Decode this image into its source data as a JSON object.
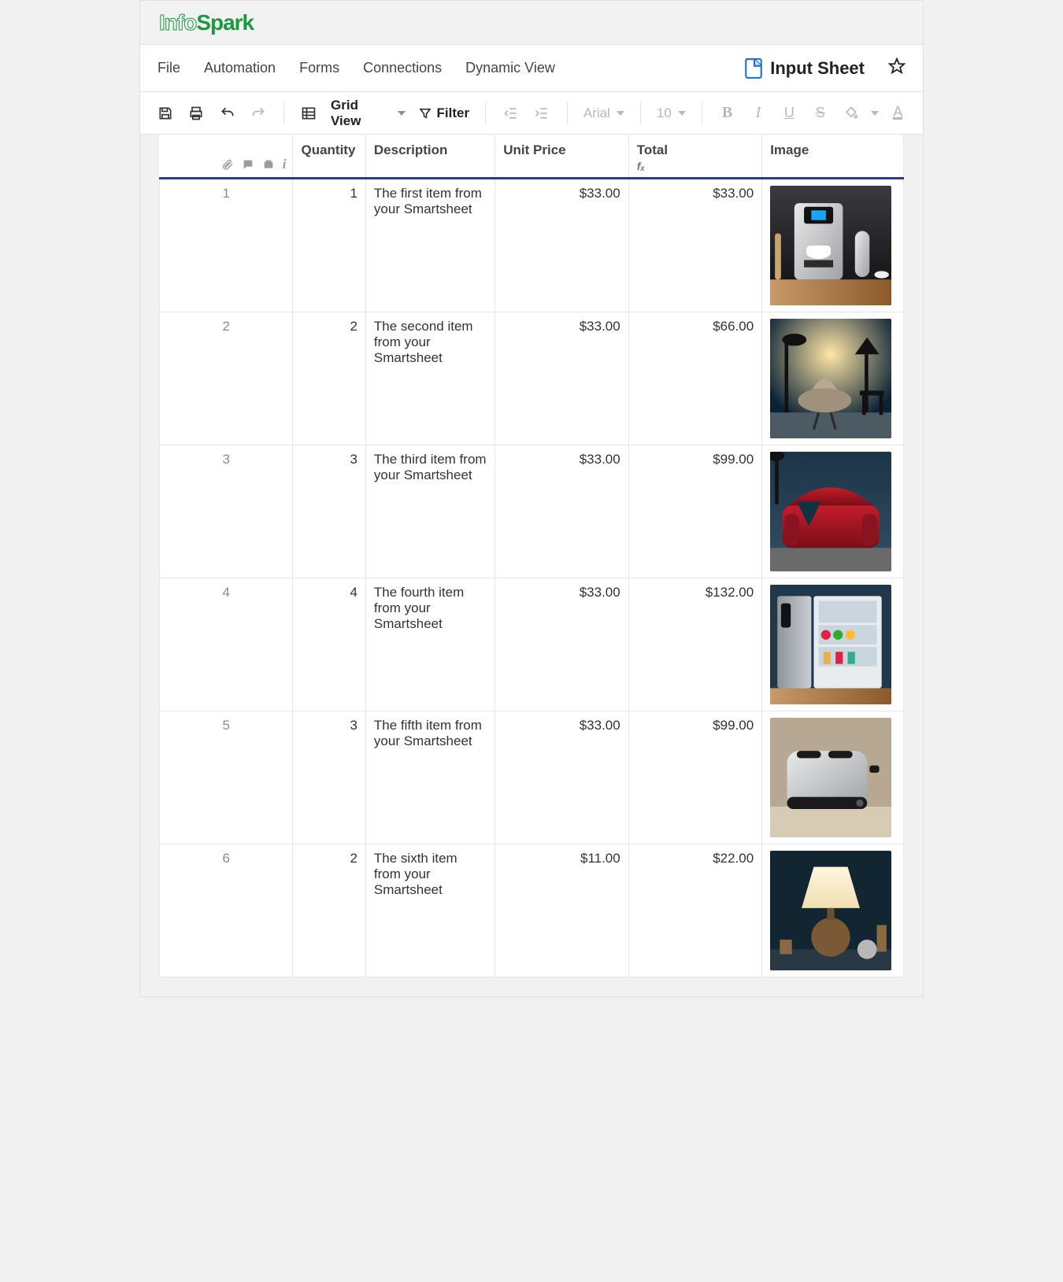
{
  "brand": {
    "part1": "Info",
    "part2": "Spark"
  },
  "menus": {
    "file": "File",
    "automation": "Automation",
    "forms": "Forms",
    "connections": "Connections",
    "dynamic_view": "Dynamic View"
  },
  "sheet": {
    "name": "Input Sheet"
  },
  "toolbar": {
    "grid_view": "Grid View",
    "filter": "Filter",
    "font": "Arial",
    "font_size": "10"
  },
  "columns": {
    "qty": "Quantity",
    "desc": "Description",
    "unit": "Unit Price",
    "total": "Total",
    "image": "Image",
    "fx": "fₓ"
  },
  "rows": [
    {
      "n": "1",
      "qty": "1",
      "desc": "The first item from your Smartsheet",
      "unit": "$33.00",
      "total": "$33.00"
    },
    {
      "n": "2",
      "qty": "2",
      "desc": "The second item from your Smartsheet",
      "unit": "$33.00",
      "total": "$66.00"
    },
    {
      "n": "3",
      "qty": "3",
      "desc": "The third item from your Smartsheet",
      "unit": "$33.00",
      "total": "$99.00"
    },
    {
      "n": "4",
      "qty": "4",
      "desc": "The fourth item from your Smartsheet",
      "unit": "$33.00",
      "total": "$132.00"
    },
    {
      "n": "5",
      "qty": "3",
      "desc": "The fifth item from your Smartsheet",
      "unit": "$33.00",
      "total": "$99.00"
    },
    {
      "n": "6",
      "qty": "2",
      "desc": "The sixth item from your Smartsheet",
      "unit": "$11.00",
      "total": "$22.00"
    }
  ]
}
